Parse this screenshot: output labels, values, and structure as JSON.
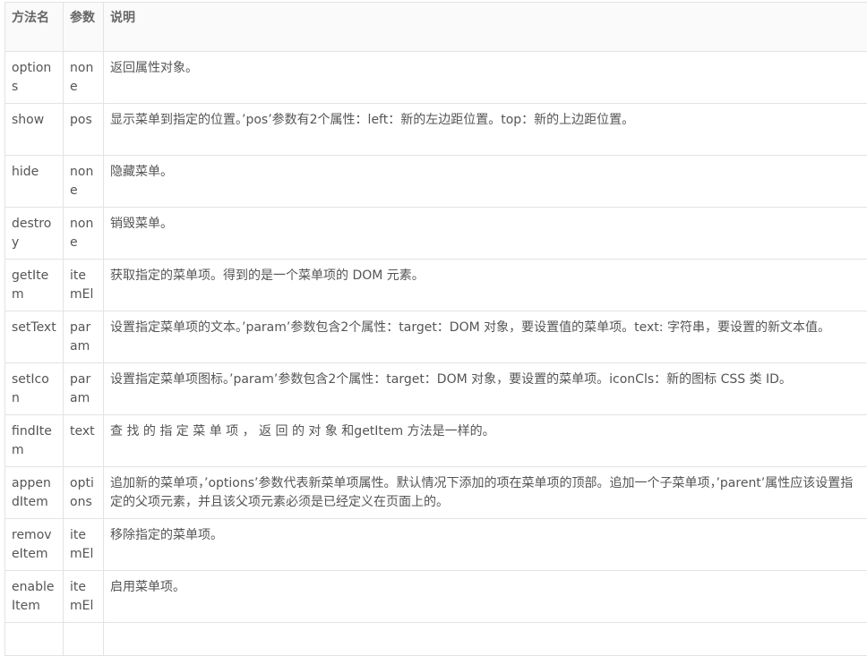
{
  "headers": {
    "name": "方法名",
    "param": "参数",
    "desc": "说明"
  },
  "rows": [
    {
      "name": "options",
      "param": "none",
      "desc": "返回属性对象。"
    },
    {
      "name": "show",
      "param": "pos",
      "desc": "显示菜单到指定的位置。’pos’参数有2个属性：left：新的左边距位置。top：新的上边距位置。"
    },
    {
      "name": "hide",
      "param": "none",
      "desc": "隐藏菜单。"
    },
    {
      "name": "destroy",
      "param": "none",
      "desc": "销毁菜单。"
    },
    {
      "name": "getItem",
      "param": "itemEl",
      "desc": "获取指定的菜单项。得到的是一个菜单项的 DOM 元素。"
    },
    {
      "name": "setText",
      "param": "param",
      "desc": "设置指定菜单项的文本。’param’参数包含2个属性：target：DOM 对象，要设置值的菜单项。text: 字符串，要设置的新文本值。"
    },
    {
      "name": "setIcon",
      "param": "param",
      "desc": "设置指定菜单项图标。’param’参数包含2个属性：target：DOM 对象，要设置的菜单项。iconCls：新的图标 CSS 类 ID。"
    },
    {
      "name": "findItem",
      "param": "text",
      "desc": "查 找 的 指 定 菜 单 项 ， 返 回 的 对 象 和getItem 方法是一样的。"
    },
    {
      "name": "appendItem",
      "param": "options",
      "desc": "追加新的菜单项，’options’参数代表新菜单项属性。默认情况下添加的项在菜单项的顶部。追加一个子菜单项，’parent’属性应该设置指定的父项元素，并且该父项元素必须是已经定义在页面上的。"
    },
    {
      "name": "removeItem",
      "param": "itemEl",
      "desc": "移除指定的菜单项。"
    },
    {
      "name": "enableItem",
      "param": "itemEl",
      "desc": "启用菜单项。"
    },
    {
      "name": "",
      "param": "",
      "desc": ""
    }
  ]
}
